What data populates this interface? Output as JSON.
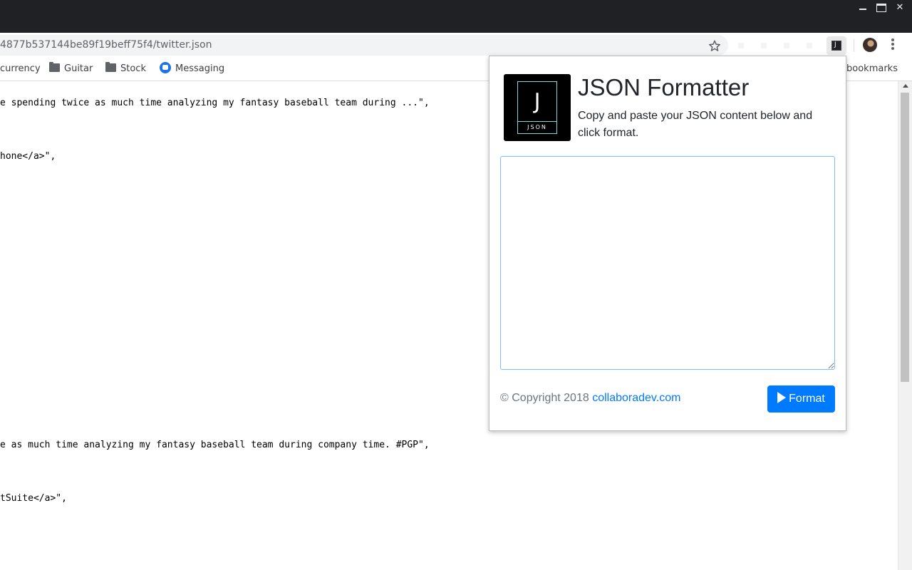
{
  "browser": {
    "url": "4877b537144be89f19beff75f4/twitter.json",
    "bookmarks": [
      {
        "label": "currency",
        "icon": "folder-icon"
      },
      {
        "label": "Guitar",
        "icon": "folder-icon"
      },
      {
        "label": "Stock",
        "icon": "folder-icon"
      },
      {
        "label": "Messaging",
        "icon": "messaging-icon"
      }
    ],
    "other_bookmarks_label": "bookmarks"
  },
  "page": {
    "lines": [
      "e spending twice as much time analyzing my fantasy baseball team during ...\",",
      "hone</a>\",",
      "e as much time analyzing my fantasy baseball team during company time. #PGP\",",
      "tSuite</a>\","
    ]
  },
  "popup": {
    "logo_letter": "J",
    "logo_text": "JSON",
    "title": "JSON Formatter",
    "description": "Copy and paste your JSON content below and click format.",
    "textarea_value": "",
    "copyright": "© Copyright 2018",
    "link_text": "collaboradev.com",
    "format_label": "Format",
    "accent": "#007bff"
  }
}
